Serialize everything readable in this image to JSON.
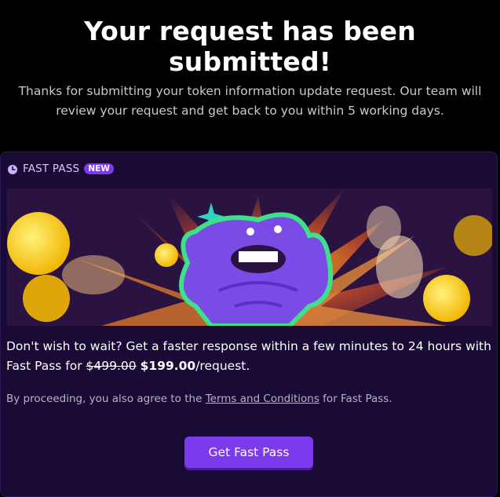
{
  "page": {
    "title": "Your request has been submitted!",
    "subtitle": "Thanks for submitting your token information update request. Our team will review your request and get back to you within 5 working days."
  },
  "fast_pass": {
    "label": "FAST PASS",
    "badge": "NEW",
    "offer_intro": "Don't wish to wait? Get a faster response within a few minutes to 24 hours with Fast Pass for ",
    "old_price": "$499.00",
    "new_price": "$199.00",
    "price_suffix": "/request.",
    "agree_prefix": "By proceeding, you also agree to the ",
    "terms_link": "Terms and Conditions",
    "agree_suffix": " for Fast Pass.",
    "button_label": "Get Fast Pass"
  },
  "colors": {
    "background": "#000000",
    "card": "#190b35",
    "accent": "#7c3aed",
    "badge": "#7c3aed"
  },
  "icons": {
    "fast_pass": "clock-icon"
  }
}
